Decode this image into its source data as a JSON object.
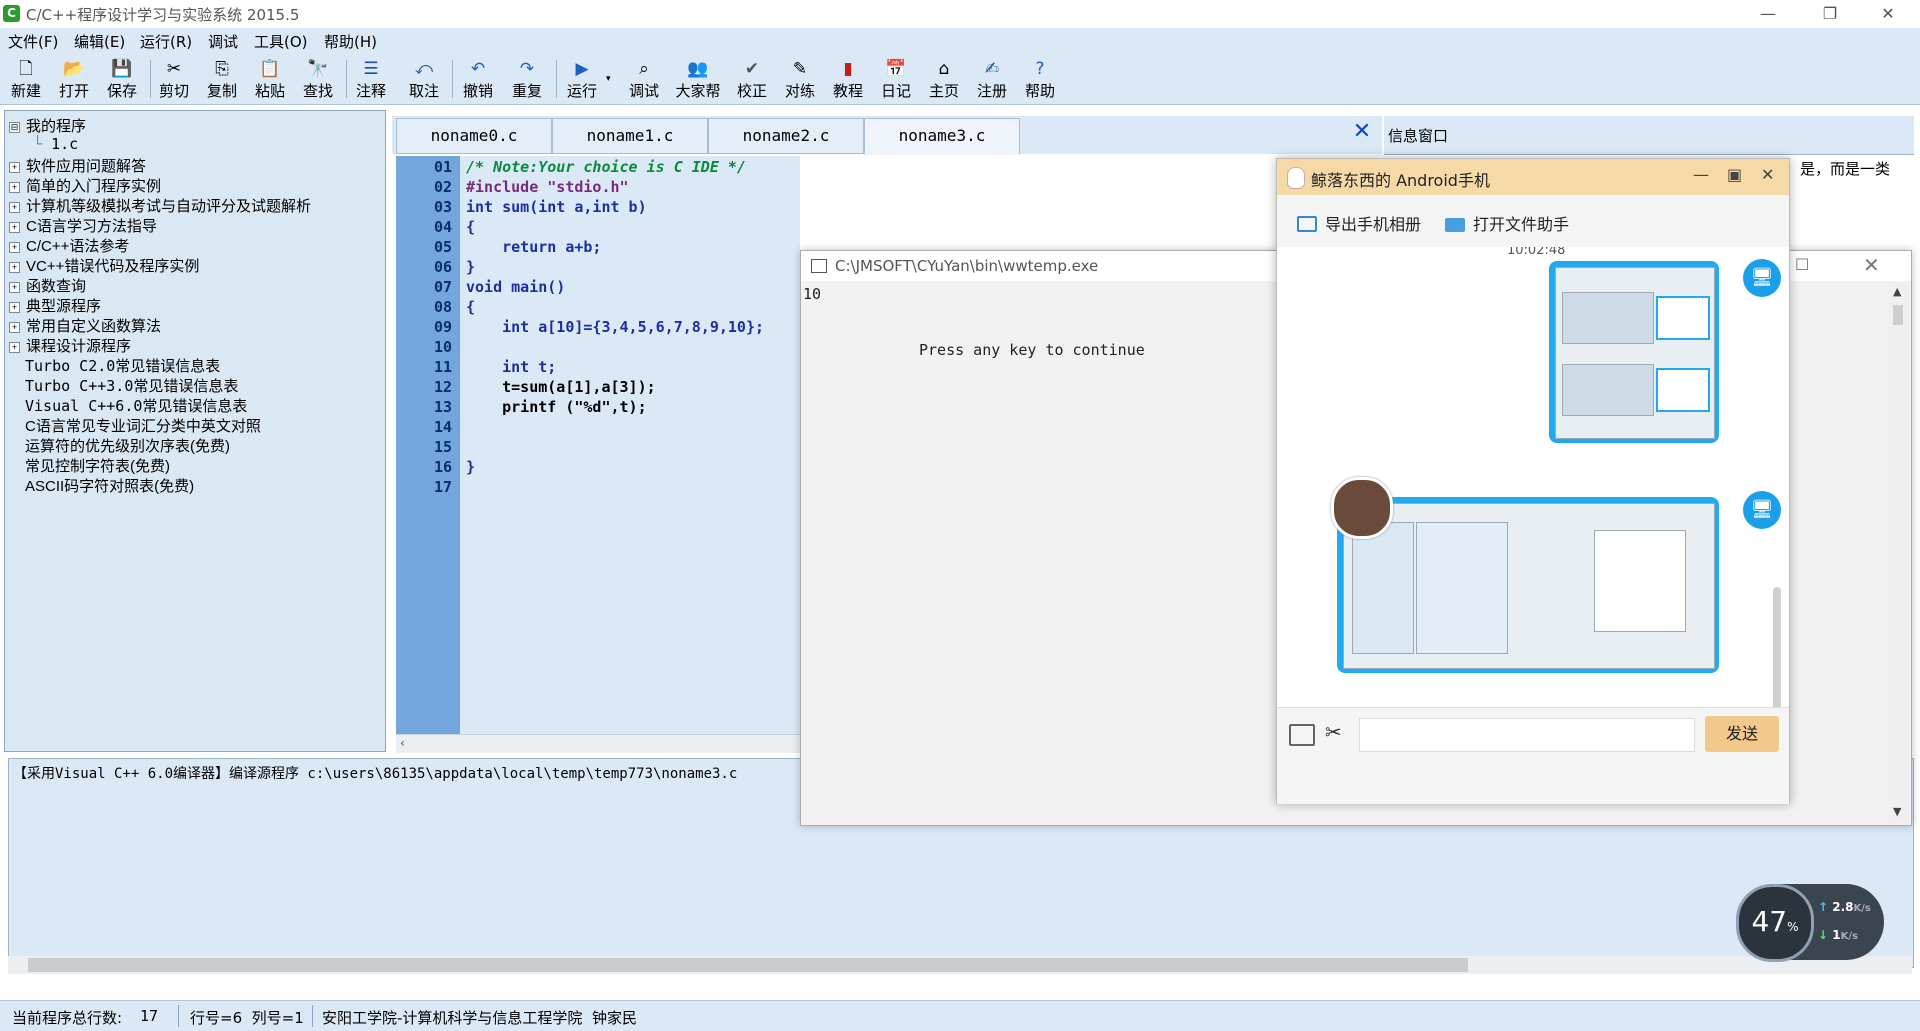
{
  "window": {
    "title": "C/C++程序设计学习与实验系统 2015.5"
  },
  "menu": [
    "文件(F)",
    "编辑(E)",
    "运行(R)",
    "调试",
    "工具(O)",
    "帮助(H)"
  ],
  "toolbar": [
    {
      "label": "新建",
      "icon": "new-file-icon"
    },
    {
      "label": "打开",
      "icon": "open-folder-icon"
    },
    {
      "label": "保存",
      "icon": "save-icon"
    },
    {
      "label": "剪切",
      "icon": "cut-icon"
    },
    {
      "label": "复制",
      "icon": "copy-icon"
    },
    {
      "label": "粘贴",
      "icon": "paste-icon"
    },
    {
      "label": "查找",
      "icon": "find-icon"
    },
    {
      "label": "注释",
      "icon": "comment-icon"
    },
    {
      "label": "取注",
      "icon": "uncomment-icon"
    },
    {
      "label": "撤销",
      "icon": "undo-icon"
    },
    {
      "label": "重复",
      "icon": "redo-icon"
    },
    {
      "label": "运行",
      "icon": "run-icon"
    },
    {
      "label": "调试",
      "icon": "debug-icon"
    },
    {
      "label": "大家帮",
      "icon": "community-icon"
    },
    {
      "label": "校正",
      "icon": "check-icon"
    },
    {
      "label": "对练",
      "icon": "practice-icon"
    },
    {
      "label": "教程",
      "icon": "tutorial-icon"
    },
    {
      "label": "日记",
      "icon": "diary-icon"
    },
    {
      "label": "主页",
      "icon": "home-icon"
    },
    {
      "label": "注册",
      "icon": "register-icon"
    },
    {
      "label": "帮助",
      "icon": "help-icon"
    }
  ],
  "tree": [
    {
      "label": "我的程序",
      "expander": "⊟"
    },
    {
      "label": "1.c",
      "expander": ""
    },
    {
      "label": "软件应用问题解答",
      "expander": "+"
    },
    {
      "label": "简单的入门程序实例",
      "expander": "+"
    },
    {
      "label": "计算机等级模拟考试与自动评分及试题解析",
      "expander": "+"
    },
    {
      "label": "C语言学习方法指导",
      "expander": "+"
    },
    {
      "label": "C/C++语法参考",
      "expander": "+"
    },
    {
      "label": "VC++错误代码及程序实例",
      "expander": "+"
    },
    {
      "label": "函数查询",
      "expander": "+"
    },
    {
      "label": "典型源程序",
      "expander": "+"
    },
    {
      "label": "常用自定义函数算法",
      "expander": "+"
    },
    {
      "label": "课程设计源程序",
      "expander": "+"
    },
    {
      "label": "Turbo C2.0常见错误信息表",
      "expander": ""
    },
    {
      "label": "Turbo C++3.0常见错误信息表",
      "expander": ""
    },
    {
      "label": "Visual C++6.0常见错误信息表",
      "expander": ""
    },
    {
      "label": "C语言常见专业词汇分类中英文对照",
      "expander": ""
    },
    {
      "label": "运算符的优先级别次序表(免费)",
      "expander": ""
    },
    {
      "label": "常见控制字符表(免费)",
      "expander": ""
    },
    {
      "label": "ASCII码字符对照表(免费)",
      "expander": ""
    }
  ],
  "editor": {
    "tabs": [
      "noname0.c",
      "noname1.c",
      "noname2.c",
      "noname3.c"
    ],
    "active_tab": 3,
    "close_glyph": "✕",
    "line_numbers": [
      "01",
      "02",
      "03",
      "04",
      "05",
      "06",
      "07",
      "08",
      "09",
      "10",
      "11",
      "12",
      "13",
      "14",
      "15",
      "16",
      "17"
    ],
    "code": [
      "/* Note:Your choice is C IDE */",
      "#include \"stdio.h\"",
      "int sum(int a,int b)",
      "{",
      "    return a+b;",
      "}",
      "void main()",
      "{",
      "    int a[10]={3,4,5,6,7,8,9,10};",
      "",
      "    int t;",
      "    t=sum(a[1],a[3]);",
      "    printf (\"%d\",t);",
      "",
      "",
      "}",
      ""
    ]
  },
  "info_window": {
    "title": "信息窗口",
    "visible_text": "是，而是一类"
  },
  "output": {
    "text": "【采用Visual C++ 6.0编译器】编译源程序 c:\\users\\86135\\appdata\\local\\temp\\temp773\\noname3.c"
  },
  "status": {
    "total_lines_label": "当前程序总行数:",
    "total_lines": "17",
    "position": "行号=6  列号=1",
    "author": "安阳工学院-计算机科学与信息工程学院  钟家民"
  },
  "console": {
    "title": "C:\\JMSOFT\\CYuYan\\bin\\wwtemp.exe",
    "output_value": "10",
    "prompt": "Press any key to continue"
  },
  "qq": {
    "title": "鲸落东西的 Android手机",
    "export_album": "导出手机相册",
    "open_file_helper": "打开文件助手",
    "time": "10:02:48",
    "send": "发送"
  },
  "speed": {
    "percent": "47",
    "percent_unit": "%",
    "up": "2.8",
    "up_unit": "K/s",
    "down": "1",
    "down_unit": "K/s"
  },
  "colors": {
    "accent_blue": "#1a9fe8",
    "panel_bg": "#dbe9f6",
    "gutter": "#74a6de",
    "qq_title": "#f5d9a7"
  }
}
